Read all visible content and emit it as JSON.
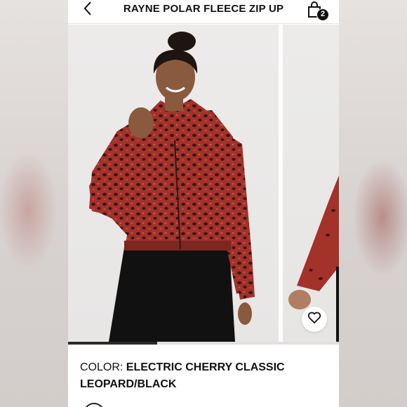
{
  "header": {
    "title": "RAYNE POLAR FLEECE ZIP UP",
    "back_icon": "chevron-left-icon",
    "bag_icon": "shopping-bag-icon",
    "bag_count": "2"
  },
  "gallery": {
    "wishlist_icon": "heart-outline-icon",
    "progress": 0.33
  },
  "product": {
    "color_label": "COLOR: ",
    "color_value": "ELECTRIC CHERRY CLASSIC LEOPARD/BLACK"
  },
  "colors": {
    "jacket": "#a3322a",
    "pants": "#111111",
    "accent": "#111111"
  }
}
